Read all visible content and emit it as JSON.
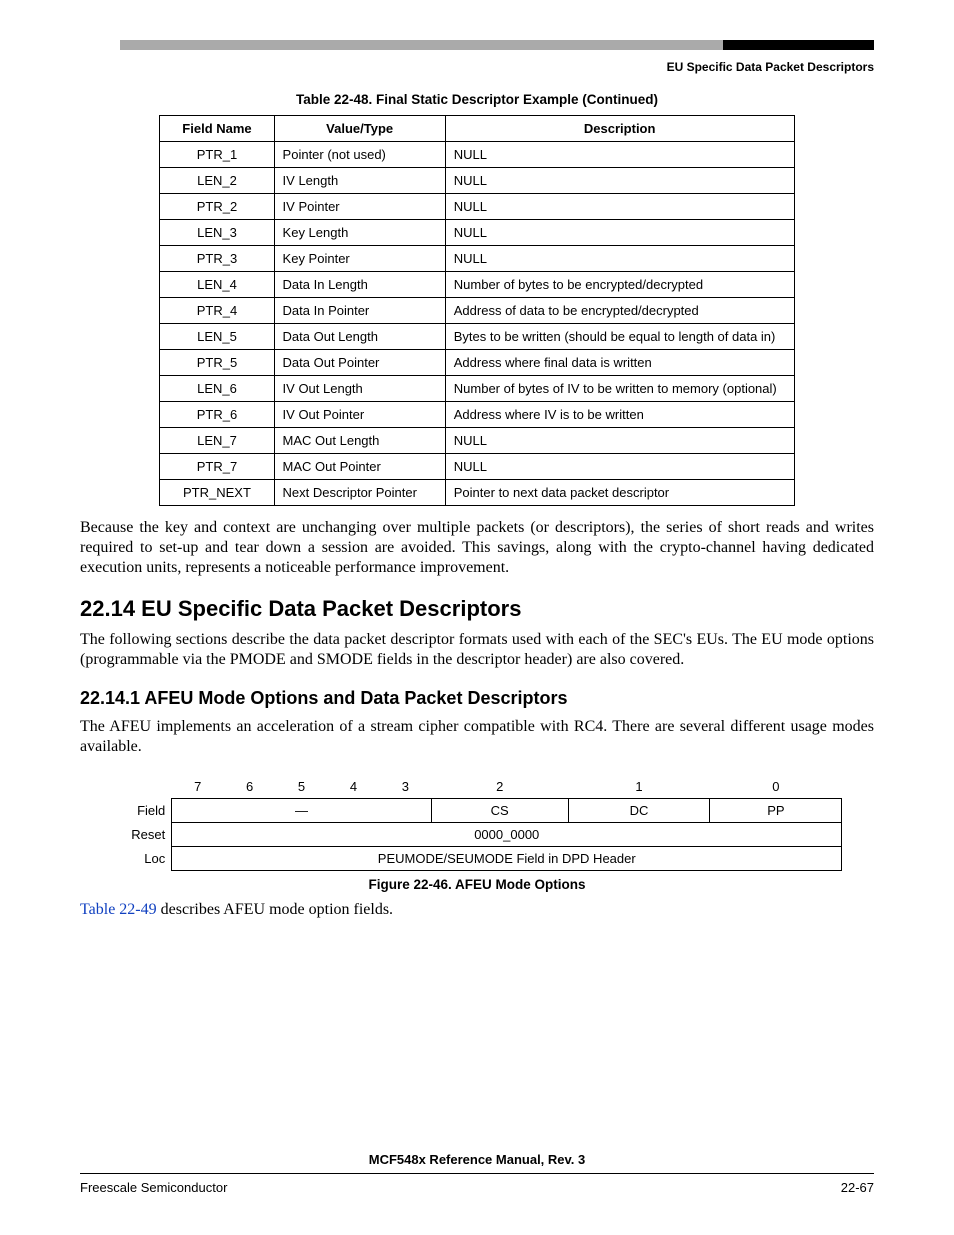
{
  "chapter_head": "EU Specific Data Packet Descriptors",
  "table48": {
    "caption": "Table 22-48. Final Static Descriptor Example (Continued)",
    "headers": {
      "field": "Field Name",
      "value": "Value/Type",
      "desc": "Description"
    },
    "rows": [
      {
        "field": "PTR_1",
        "value": "Pointer (not used)",
        "desc": "NULL"
      },
      {
        "field": "LEN_2",
        "value": "IV Length",
        "desc": "NULL"
      },
      {
        "field": "PTR_2",
        "value": "IV Pointer",
        "desc": "NULL"
      },
      {
        "field": "LEN_3",
        "value": "Key Length",
        "desc": "NULL"
      },
      {
        "field": "PTR_3",
        "value": "Key Pointer",
        "desc": "NULL"
      },
      {
        "field": "LEN_4",
        "value": "Data In Length",
        "desc": "Number of bytes to be encrypted/decrypted"
      },
      {
        "field": "PTR_4",
        "value": "Data In Pointer",
        "desc": "Address of data to be encrypted/decrypted"
      },
      {
        "field": "LEN_5",
        "value": "Data Out Length",
        "desc": "Bytes to be written (should be equal to length of data in)"
      },
      {
        "field": "PTR_5",
        "value": "Data Out Pointer",
        "desc": "Address where final data is written"
      },
      {
        "field": "LEN_6",
        "value": "IV Out Length",
        "desc": "Number of bytes of IV to be written to memory (optional)"
      },
      {
        "field": "PTR_6",
        "value": "IV Out Pointer",
        "desc": "Address where IV is to be written"
      },
      {
        "field": "LEN_7",
        "value": "MAC Out Length",
        "desc": "NULL"
      },
      {
        "field": "PTR_7",
        "value": "MAC Out Pointer",
        "desc": "NULL"
      },
      {
        "field": "PTR_NEXT",
        "value": "Next Descriptor Pointer",
        "desc": "Pointer to next data packet descriptor"
      }
    ]
  },
  "para_after_table": "Because the key and context are unchanging over multiple packets (or descriptors), the series of short reads and writes required to set-up and tear down a session are avoided. This savings, along with the crypto-channel having dedicated execution units, represents a noticeable performance improvement.",
  "section_22_14": {
    "title": "22.14   EU Specific Data Packet Descriptors",
    "para": "The following sections describe the data packet descriptor formats used with each of the SEC's EUs. The EU mode options (programmable via the PMODE and SMODE fields in the descriptor header) are also covered."
  },
  "section_22_14_1": {
    "title": "22.14.1  AFEU Mode Options and Data Packet Descriptors",
    "para": "The AFEU implements an acceleration of a stream cipher compatible with RC4. There are several different usage modes available."
  },
  "regfig": {
    "bits": [
      "7",
      "6",
      "5",
      "4",
      "3",
      "2",
      "1",
      "0"
    ],
    "row_labels": {
      "field": "Field",
      "reset": "Reset",
      "loc": "Loc"
    },
    "field_cells": {
      "dash": "—",
      "cs": "CS",
      "dc": "DC",
      "pp": "PP"
    },
    "reset": "0000_0000",
    "loc": "PEUMODE/SEUMODE Field in DPD Header",
    "caption": "Figure 22-46. AFEU Mode Options"
  },
  "after_fig": {
    "link_text": "Table 22-49",
    "rest": " describes AFEU mode option fields."
  },
  "footer": {
    "book": "MCF548x Reference Manual, Rev. 3",
    "left": "Freescale Semiconductor",
    "right": "22-67"
  }
}
